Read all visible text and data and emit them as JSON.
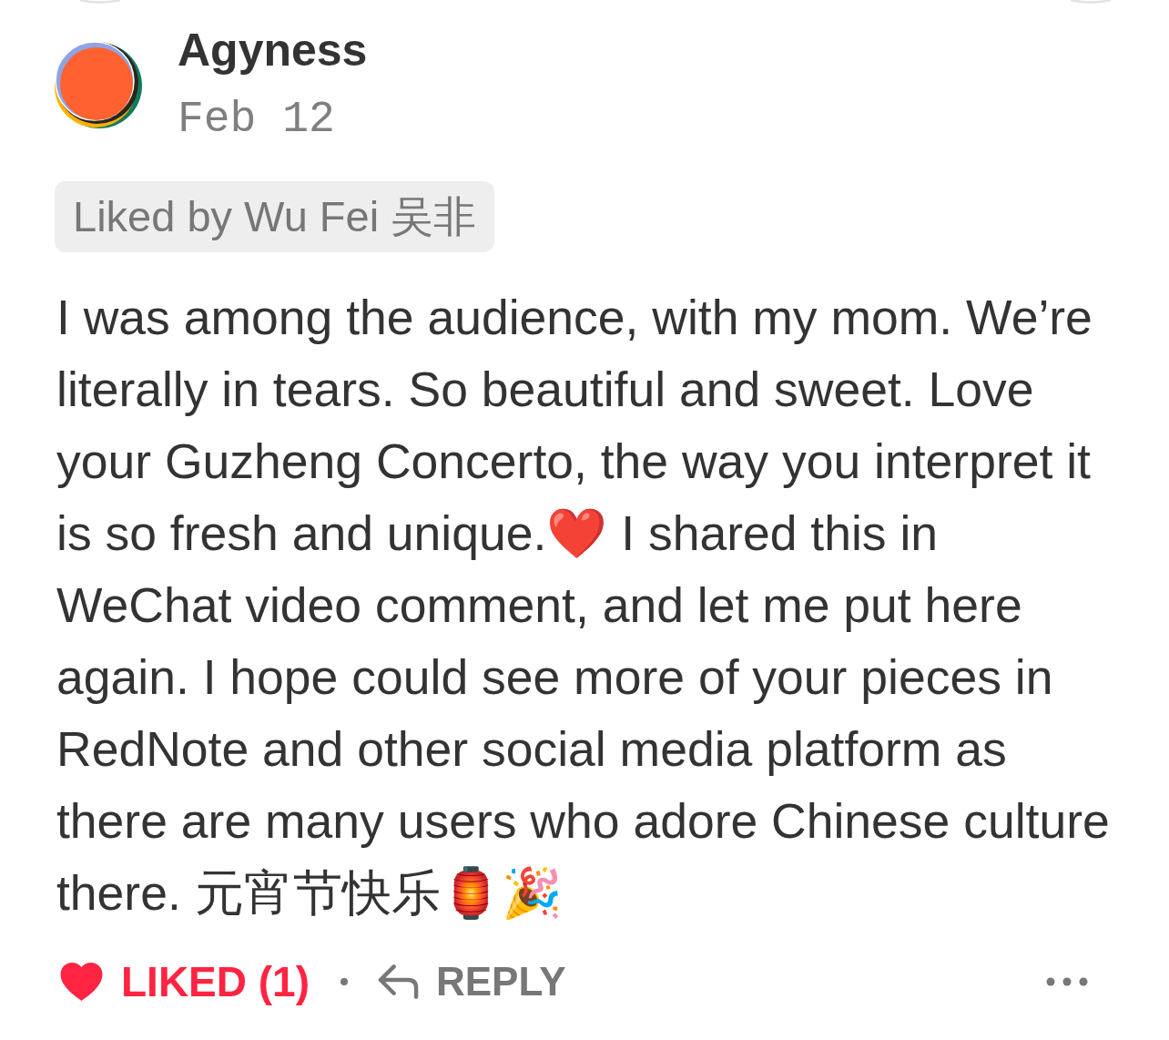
{
  "comment": {
    "author": "Agyness",
    "date": "Feb 12",
    "liked_by": "Liked by Wu Fei 吴非",
    "text": "I was among the audience, with my mom. We’re literally in tears. So beautiful and sweet. Love your Guzheng Concerto, the way you interpret it is so fresh and unique.❤️ I shared this in WeChat video comment, and let me put here again. I hope could see more of your pieces in RedNote and other social media platform as there are many users who adore Chinese culture there. 元宵节快乐🏮🎉",
    "actions": {
      "like": {
        "label": "LIKED (1)",
        "liked": true
      },
      "reply": {
        "label": "REPLY"
      }
    }
  }
}
